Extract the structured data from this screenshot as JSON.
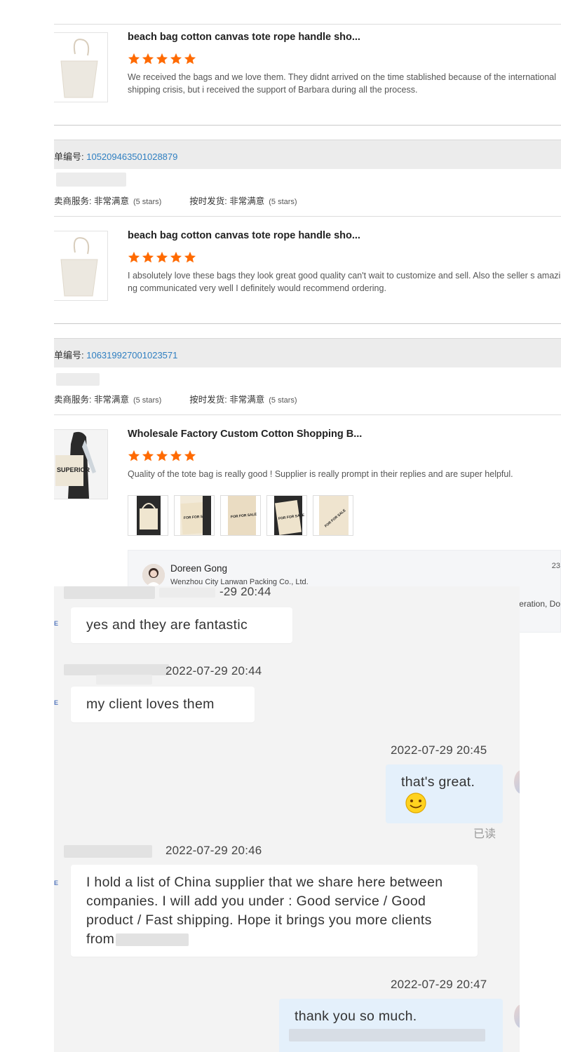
{
  "reviews": [
    {
      "title": "beach bag cotton canvas tote rope handle sho...",
      "stars": 5,
      "text": "We received the bags and we love them. They didnt arrived on the time stablished because of the international shipping crisis, but i received the support of Barbara during all the process."
    },
    {
      "order_label": "单编号: ",
      "order_number": "105209463501028879",
      "service_label": "卖商服务: 非常满意",
      "service_stars_note": "(5 stars)",
      "shipping_label": "按时发货: 非常满意",
      "shipping_stars_note": "(5 stars)",
      "title": "beach bag cotton canvas tote rope handle sho...",
      "stars": 5,
      "text": "I absolutely love these bags they look great good quality can't wait to customize and sell. Also the seller s amazing communicated very well I definitely would recommend ordering."
    },
    {
      "order_label": "单编号: ",
      "order_number": "106319927001023571",
      "service_label": "卖商服务: 非常满意",
      "service_stars_note": "(5 stars)",
      "shipping_label": "按时发货: 非常满意",
      "shipping_stars_note": "(5 stars)",
      "title": "Wholesale Factory Custom Cotton Shopping B...",
      "stars": 5,
      "text": "Quality of the tote bag is really good ! Supplier is really prompt in their replies and are super helpful.",
      "photo_count": 5,
      "thumb_print": "SUPERIOR",
      "photo_print": "FOR FOR SALE"
    }
  ],
  "supplier_reply": {
    "name": "Doreen Gong",
    "company": "Wenzhou City Lanwan Packing Co., Ltd.",
    "date_partial": "23",
    "text_partial": "eration, Do"
  },
  "chat": {
    "messages": [
      {
        "direction": "in",
        "time": "2022-07-29 20:44",
        "time_visible": "-29 20:44",
        "text": "yes and they are fantastic"
      },
      {
        "direction": "in",
        "time": "2022-07-29 20:44",
        "time_visible": "2022-07-29 20:44",
        "text": "my client loves them"
      },
      {
        "direction": "out",
        "time": "2022-07-29 20:45",
        "text": "that's great.",
        "emoji": "smiley",
        "status": "已读"
      },
      {
        "direction": "in",
        "time": "2022-07-29 20:46",
        "text": "I hold a list of China supplier that we share here between companies. I will add you under : Good service / Good product / Fast shipping. Hope it brings you more clients from"
      },
      {
        "direction": "out",
        "time": "2022-07-29 20:47",
        "text": "thank you so much."
      }
    ]
  },
  "colors": {
    "star": "#ff6a00",
    "order_number": "#2f7fc1",
    "chat_bg": "#f3f3f3",
    "bubble_out": "#e4f0fb"
  }
}
